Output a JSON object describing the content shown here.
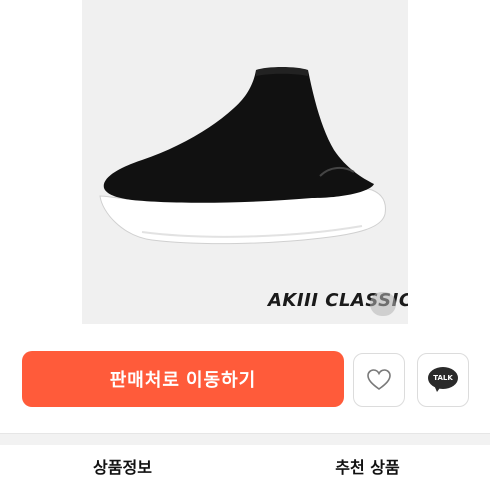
{
  "product": {
    "brand_logo_text": "AKIII CLASSIC",
    "image_icon": "sock-sneaker-image",
    "colors": {
      "image_bg": "#f0f0f0",
      "shoe_upper": "#111111",
      "sole": "#ffffff"
    }
  },
  "actions": {
    "buy_label": "판매처로 이동하기",
    "wish_icon": "heart-icon",
    "talk_label": "TALK",
    "talk_icon": "kakao-talk-icon"
  },
  "tabs": [
    {
      "label": "상품정보"
    },
    {
      "label": "추천 상품"
    }
  ],
  "colors": {
    "accent": "#ff5b3a",
    "border": "#dcdcdc",
    "divider": "#f2f2f2"
  }
}
